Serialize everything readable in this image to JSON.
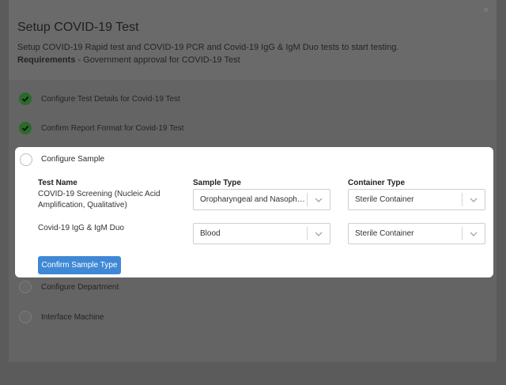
{
  "modal": {
    "title": "Setup COVID-19 Test",
    "subtitle": "Setup COVID-19 Rapid test and COVID-19 PCR and Covid-19 IgG & IgM Duo tests to start testing.",
    "requirements_label": "Requirements",
    "requirements_text": " - Government approval for COVID-19 Test",
    "close_glyph": "×"
  },
  "steps": [
    {
      "label": "Configure Test Details for Covid-19 Test",
      "status": "done"
    },
    {
      "label": "Confirm Report Format for Covid-19 Test",
      "status": "done"
    },
    {
      "label": "Configure Sample",
      "status": "active"
    },
    {
      "label": "Configure Department",
      "status": "todo"
    },
    {
      "label": "Interface Machine",
      "status": "todo"
    }
  ],
  "sample_panel": {
    "headers": {
      "test_name": "Test Name",
      "sample_type": "Sample Type",
      "container_type": "Container Type"
    },
    "rows": [
      {
        "test_name": "COVID-19 Screening (Nucleic Acid Amplification, Qualitative)",
        "sample_type": "Oropharyngeal and Nasopha...",
        "container_type": "Sterile Container"
      },
      {
        "test_name": "Covid-19 IgG & IgM Duo",
        "sample_type": "Blood",
        "container_type": "Sterile Container"
      }
    ],
    "confirm_label": "Confirm Sample Type"
  },
  "colors": {
    "accent": "#3f88d5",
    "done": "#2a6b2a",
    "overlay": "#5b5b5b"
  },
  "icons": {
    "done": "checkmark-icon",
    "dropdown": "chevron-down-icon",
    "close": "close-icon"
  }
}
